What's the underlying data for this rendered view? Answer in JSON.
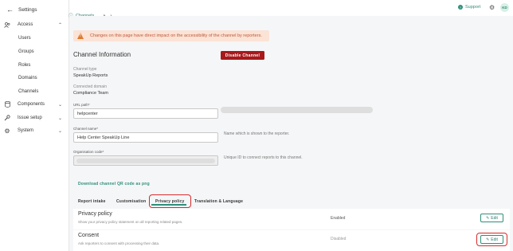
{
  "sidebar": {
    "header_label": "Settings",
    "sections": [
      {
        "label": "Access",
        "icon": "users-icon"
      },
      {
        "label": "Components",
        "icon": "database-icon"
      },
      {
        "label": "Issue setup",
        "icon": "wrench-icon"
      },
      {
        "label": "System",
        "icon": "gear-icon"
      }
    ],
    "access_items": [
      "Users",
      "Groups",
      "Roles",
      "Domains",
      "Channels"
    ]
  },
  "topbar": {
    "breadcrumb": "Channels",
    "breadcrumb_sep": "»",
    "breadcrumb_tail": "›",
    "support_label": "Support",
    "avatar_initials": "KD"
  },
  "alert": {
    "text": "Changes on this page have direct impact on the accessibility of the channel by reporters."
  },
  "channel_info": {
    "title": "Channel Information",
    "disable_button": "Disable Channel",
    "channel_type_label": "Channel type",
    "channel_type_value": "SpeakUp Reports",
    "connected_domain_label": "Connected domain",
    "connected_domain_value": "Compliance Team"
  },
  "form": {
    "url_path_label": "URL path*",
    "url_path_value": "helpcenter",
    "channel_name_label": "Channel name*",
    "channel_name_value": "Help Center SpeakUp Line",
    "channel_name_hint": "Name which is shown to the reporter.",
    "org_code_label": "Organisation code*",
    "org_code_hint": "Unique ID to connect reports to this channel."
  },
  "qr_link": "Download channel QR code as png",
  "tabs": [
    "Report intake",
    "Customisation",
    "Privacy policy",
    "Translation & Language"
  ],
  "active_tab": "Privacy policy",
  "rows": [
    {
      "title": "Privacy policy",
      "subtitle": "Show your privacy policy statement on all reporting related pages.",
      "status": "Enabled",
      "edit_label": "Edit"
    },
    {
      "title": "Consent",
      "subtitle": "Ask reporters to consent with processing their data.",
      "status": "Disabled",
      "edit_label": "Edit"
    }
  ],
  "colors": {
    "accent": "#2f8f7a",
    "danger": "#a8191b",
    "highlight": "#d92a2a",
    "alert_bg": "#fbe3d6"
  }
}
